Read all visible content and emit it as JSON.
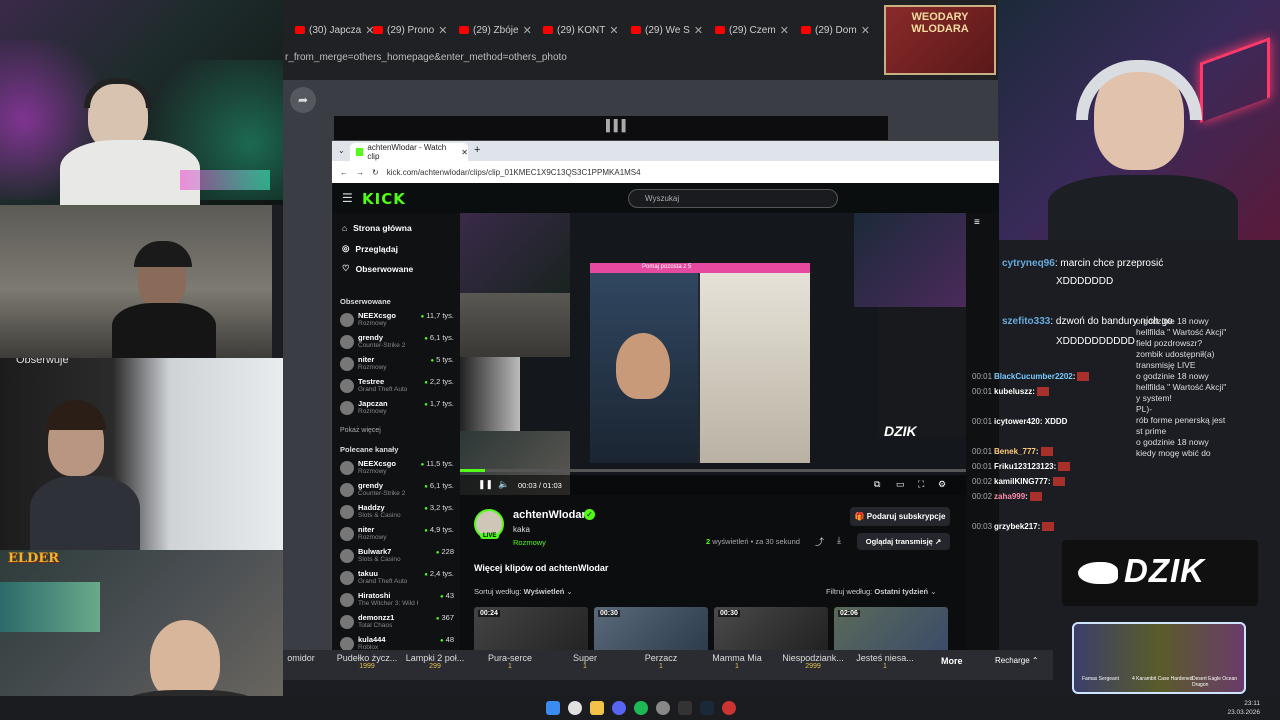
{
  "browser_tabs": [
    {
      "label": "(30) Japcza"
    },
    {
      "label": "(29) Prono"
    },
    {
      "label": "(29) Zbóje"
    },
    {
      "label": "(29) KONT"
    },
    {
      "label": "(29) We S"
    },
    {
      "label": "(29) Czem"
    },
    {
      "label": "(29) Dom"
    }
  ],
  "url_fragment": "r_from_merge=others_homepage&enter_method=others_photo",
  "weogo_text": "WEODARY WLODARA",
  "obs_label": "Obserwuje",
  "elder_label": "ELDER",
  "inner_browser": {
    "tab_title": "achtenWlodar - Watch clip",
    "url": "kick.com/achtenwlodar/clips/clip_01KMEC1X9C13QS3C1PPMKA1MS4",
    "logo": "KICK",
    "search_placeholder": "Wyszukaj"
  },
  "kick_nav": [
    {
      "label": "Strona główna",
      "icon": "home-icon"
    },
    {
      "label": "Przeglądaj",
      "icon": "compass-icon"
    },
    {
      "label": "Obserwowane",
      "icon": "heart-icon"
    }
  ],
  "followed_title": "Obserwowane",
  "followed": [
    {
      "name": "NEEXcsgo",
      "cat": "Rozmowy",
      "views": "11,7 tys."
    },
    {
      "name": "grendy",
      "cat": "Counter-Strike 2",
      "views": "6,1 tys."
    },
    {
      "name": "niter",
      "cat": "Rozmowy",
      "views": "5 tys."
    },
    {
      "name": "Testree",
      "cat": "Grand Theft Auto",
      "views": "2,2 tys."
    },
    {
      "name": "Japczan",
      "cat": "Rozmowy",
      "views": "1,7 tys."
    }
  ],
  "show_more": "Pokaż więcej",
  "recommended_title": "Polecane kanały",
  "recommended": [
    {
      "name": "NEEXcsgo",
      "cat": "Rozmowy",
      "views": "11,5 tys."
    },
    {
      "name": "grendy",
      "cat": "Counter-Strike 2",
      "views": "6,1 tys."
    },
    {
      "name": "Haddzy",
      "cat": "Slots & Casino",
      "views": "3,2 tys."
    },
    {
      "name": "niter",
      "cat": "Rozmowy",
      "views": "4,9 tys."
    },
    {
      "name": "Bulwark7",
      "cat": "Slots & Casino",
      "views": "228"
    },
    {
      "name": "takuu",
      "cat": "Grand Theft Auto",
      "views": "2,4 tys."
    },
    {
      "name": "Hiratoshi",
      "cat": "The Witcher 3: Wild Hunt",
      "views": "43"
    },
    {
      "name": "demonzz1",
      "cat": "Total Chaos",
      "views": "367"
    },
    {
      "name": "kula444",
      "cat": "Roblox",
      "views": "48"
    }
  ],
  "video": {
    "time": "00:03 / 01:03",
    "progress": 0.05,
    "dzik_text": "DZIK",
    "phone_caption": "Pomaj pozosta z 5"
  },
  "clip": {
    "channel": "achtenWlodar",
    "live": "LIVE",
    "title": "kaka",
    "category": "Rozmowy",
    "subscribe": "Podaruj subskrypcje",
    "views_count": "2",
    "views_text": "wyświetleń • za 30 sekund",
    "watch_stream": "Oglądaj transmisję",
    "more_clips": "Więcej klipów od achtenWlodar",
    "sort_label": "Sortuj według:",
    "sort_value": "Wyświetleń",
    "filter_label": "Filtruj według:",
    "filter_value": "Ostatni tydzień",
    "thumbs": [
      {
        "duration": "00:24"
      },
      {
        "duration": "00:30"
      },
      {
        "duration": "00:30"
      },
      {
        "duration": "02:06"
      }
    ]
  },
  "overlay_chat": [
    {
      "user": "cytryneq96",
      "text": "marcin chce przeprosić"
    },
    {
      "user": "",
      "text": "XDDDDDDD"
    },
    {
      "user": "szefito333",
      "text": "dzwoń do bandury nich go"
    },
    {
      "user": "",
      "text": "XDDDDDDDDDD"
    }
  ],
  "inner_chat": [
    {
      "time": "00:01",
      "user": "BlackCucumber2202",
      "text": ""
    },
    {
      "time": "00:01",
      "user": "kubeluszz",
      "text": ""
    },
    {
      "time": "00:01",
      "user": "icytower420",
      "text": "XDDD"
    },
    {
      "time": "00:01",
      "user": "Benek_777",
      "text": ""
    },
    {
      "time": "00:01",
      "user": "Friku123123123",
      "text": ""
    },
    {
      "time": "00:02",
      "user": "kamilKING777",
      "text": ""
    },
    {
      "time": "00:02",
      "user": "zaha999",
      "text": ""
    },
    {
      "time": "00:03",
      "user": "grzybek217",
      "text": ""
    }
  ],
  "right_text": [
    "o godzinie 18 nowy",
    "hellfilda \" Wartość Akcji\"",
    "field pozdrowszr?",
    "zombik udostępnił(a)",
    "transmisję LIVE",
    "o godzinie 18 nowy",
    "hellfilda \" Wartość Akcji\"",
    "y system!",
    "PL)-",
    "rób forme penerską jest",
    "st prime",
    "o godzinie 18 nowy",
    "kiedy mogę wbić do"
  ],
  "dzik_logo": "DZIK",
  "skins": [
    "Famas Sergeant",
    "4 Karambit Case Hardened",
    "Desert Eagle Ocean Dragon"
  ],
  "rewards": [
    {
      "name": "omidor",
      "cost": ""
    },
    {
      "name": "Pudełko życz...",
      "cost": "1999"
    },
    {
      "name": "Lampki 2 poł...",
      "cost": "299"
    },
    {
      "name": "Pura-serce",
      "cost": "1"
    },
    {
      "name": "Super",
      "cost": "1"
    },
    {
      "name": "Perzacz",
      "cost": "1"
    },
    {
      "name": "Mamma Mia",
      "cost": "1"
    },
    {
      "name": "Niespodziank...",
      "cost": "2999"
    },
    {
      "name": "Jesteś niesa...",
      "cost": "1"
    }
  ],
  "rewards_more": "More",
  "rewards_recharge": "Recharge",
  "clock": {
    "time": "23:11",
    "date": "23.03.2026"
  },
  "colors": {
    "kick_green": "#53fc18",
    "youtube_red": "#ff0000"
  }
}
